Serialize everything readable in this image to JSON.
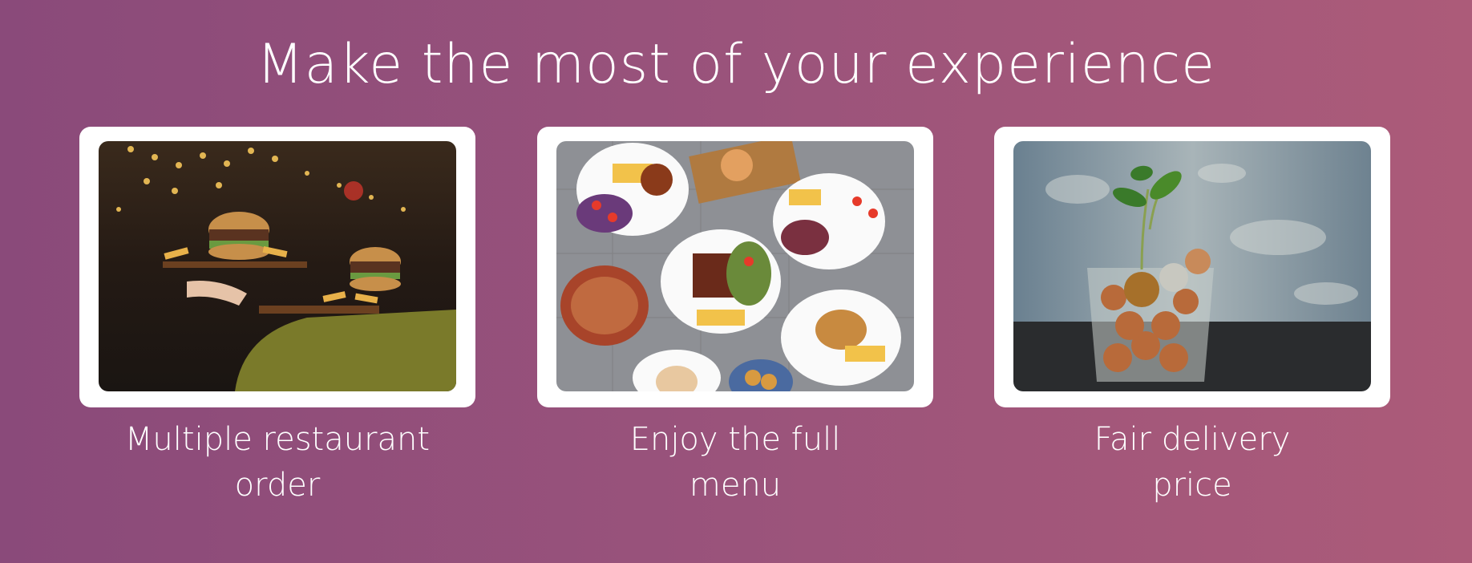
{
  "heading": "Make the most of your experience",
  "features": [
    {
      "caption_line1": "Multiple restaurant",
      "caption_line2": "order",
      "image": "burgers-served-on-trays-photo"
    },
    {
      "caption_line1": "Enjoy the full",
      "caption_line2": "menu",
      "image": "table-of-dishes-photo"
    },
    {
      "caption_line1": "Fair delivery",
      "caption_line2": "price",
      "image": "coins-in-glass-with-plant-photo"
    }
  ],
  "colors": {
    "gradient_start": "#8a4a7a",
    "gradient_end": "#ac5b79",
    "card": "#ffffff",
    "text": "#ffffff"
  }
}
